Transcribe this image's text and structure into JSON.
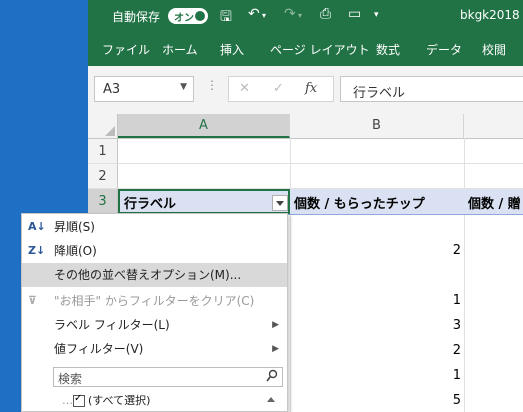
{
  "titlebar": {
    "autosave_label": "自動保存",
    "autosave_state": "オン",
    "filename": "bkgk2018"
  },
  "ribbon": {
    "tabs": [
      "ファイル",
      "ホーム",
      "挿入",
      "ページ レイアウト",
      "数式",
      "データ",
      "校閲"
    ]
  },
  "formula_bar": {
    "name_box": "A3",
    "formula": "行ラベル",
    "fx": "fx"
  },
  "grid": {
    "columns": [
      "A",
      "B"
    ],
    "rows": [
      "1",
      "2",
      "3"
    ],
    "a3_text": "行ラベル",
    "b3_text": "個数 / もらったチップ",
    "c3_text": "個数 / 贈",
    "values": [
      "2",
      "1",
      "3",
      "2",
      "1",
      "5"
    ]
  },
  "menu": {
    "sort_asc": "昇順(S)",
    "sort_desc": "降順(O)",
    "more_sort": "その他の並べ替えオプション(M)...",
    "clear_filter": "\"お相手\" からフィルターをクリア(C)",
    "label_filter": "ラベル フィルター(L)",
    "value_filter": "値フィルター(V)",
    "search_placeholder": "検索",
    "select_all": "(すべて選択)"
  }
}
